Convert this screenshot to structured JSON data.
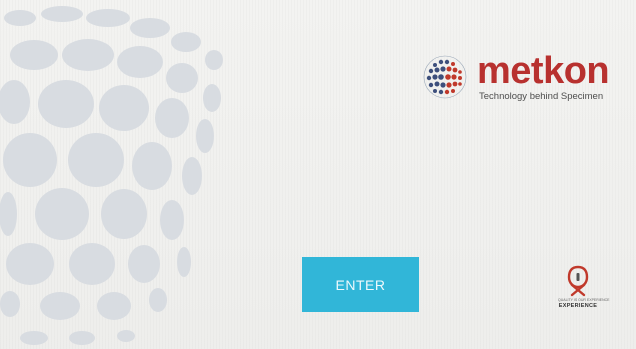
{
  "brand": {
    "name": "metkon",
    "tagline": "Technology behind Specimen",
    "color": "#b8312f",
    "logo_icon": "dotted-globe-icon"
  },
  "enter_button": {
    "label": "ENTER",
    "color": "#31b6d8"
  },
  "experience_badge": {
    "small_text": "QUALITY IS OUR EXPERIENCE",
    "label": "EXPERIENCE",
    "icon": "quality-seal-icon"
  },
  "background": {
    "decoration": "dotted-sphere",
    "color": "#f1f1ef"
  }
}
